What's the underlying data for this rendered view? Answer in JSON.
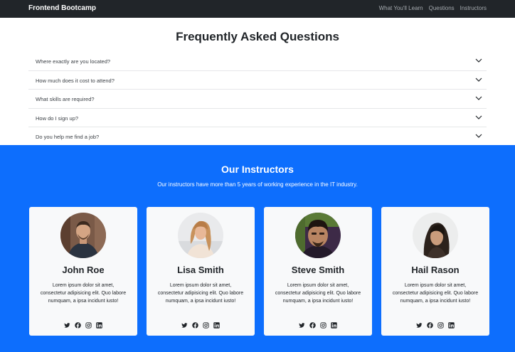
{
  "navbar": {
    "brand": "Frontend Bootcamp",
    "links": [
      {
        "label": "What You'll Learn"
      },
      {
        "label": "Questions"
      },
      {
        "label": "Instructors"
      }
    ]
  },
  "faq": {
    "title": "Frequently Asked Questions",
    "items": [
      {
        "question": "Where exactly are you located?"
      },
      {
        "question": "How much does it cost to attend?"
      },
      {
        "question": "What skills are required?"
      },
      {
        "question": "How do I sign up?"
      },
      {
        "question": "Do you help me find a job?"
      }
    ]
  },
  "instructors": {
    "title": "Our Instructors",
    "subtitle": "Our instructors have more than 5 years of working experience in the IT industry.",
    "cards": [
      {
        "name": "John Roe",
        "bio": "Lorem ipsum dolor sit amet, consectetur adipisicing elit. Quo labore numquam, a ipsa incidunt iusto!"
      },
      {
        "name": "Lisa Smith",
        "bio": "Lorem ipsum dolor sit amet, consectetur adipisicing elit. Quo labore numquam, a ipsa incidunt iusto!"
      },
      {
        "name": "Steve Smith",
        "bio": "Lorem ipsum dolor sit amet, consectetur adipisicing elit. Quo labore numquam, a ipsa incidunt iusto!"
      },
      {
        "name": "Hail Rason",
        "bio": "Lorem ipsum dolor sit amet, consectetur adipisicing elit. Quo labore numquam, a ipsa incidunt iusto!"
      }
    ],
    "social_icons": [
      "twitter-icon",
      "facebook-icon",
      "instagram-icon",
      "linkedin-icon"
    ]
  },
  "colors": {
    "navbar_bg": "#212529",
    "primary": "#0d6efd",
    "card_bg": "#f8f9fa"
  }
}
